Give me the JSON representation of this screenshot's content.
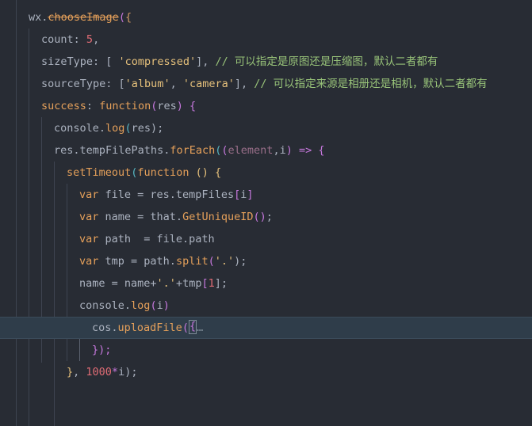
{
  "colors": {
    "background": "#282c34",
    "current_line": "#2f3d4a",
    "comment": "#98c379",
    "string": "#e5c07b",
    "keyword": "#c678dd",
    "function": "#61afef",
    "number": "#e06c75"
  },
  "lines": {
    "l0": {
      "tokens": [
        "wx",
        ".",
        "chooseImage",
        "(",
        "{"
      ]
    },
    "l1": {
      "tokens": [
        "count",
        ":",
        " ",
        "5",
        ","
      ]
    },
    "l2": {
      "tokens": [
        "sizeType",
        ": [ ",
        "'compressed'",
        "], ",
        "// 可以指定是原图还是压缩图，默认二者都有"
      ]
    },
    "l3": {
      "tokens": [
        "sourceType",
        ": [",
        "'album'",
        ", ",
        "'camera'",
        "], ",
        "// 可以指定来源是相册还是相机，默认二者都有"
      ]
    },
    "l4": {
      "tokens": [
        "success",
        ": ",
        "function",
        "(",
        "res",
        ") ",
        "{"
      ]
    },
    "l5": {
      "tokens": [
        "console",
        ".",
        "log",
        "(",
        "res",
        ");"
      ]
    },
    "l6": {
      "tokens": [
        "res",
        ".",
        "tempFilePaths",
        ".",
        "forEach",
        "(",
        "(",
        "element",
        ",",
        "i",
        ")",
        " => ",
        "{"
      ]
    },
    "l7": {
      "tokens": [
        "setTimeout",
        "(",
        "function",
        " ",
        "()",
        " ",
        "{"
      ]
    },
    "l8": {
      "tokens": [
        "var",
        " file = res.tempFiles",
        "[",
        "i",
        "]"
      ]
    },
    "l9": {
      "tokens": [
        "var",
        " name = that.",
        "GetUniqueID",
        "()",
        ";"
      ]
    },
    "l10": {
      "tokens": [
        "var",
        " path  = file.path"
      ]
    },
    "l11": {
      "tokens": [
        "var",
        " tmp = path.",
        "split",
        "(",
        "'.'",
        ");"
      ]
    },
    "l12": {
      "tokens": [
        "name = name+",
        "'.'",
        "+tmp",
        "[",
        "1",
        "];"
      ]
    },
    "l13": {
      "tokens": [
        "console",
        ".",
        "log",
        "(",
        "i",
        ")"
      ]
    },
    "l14": {
      "tokens": [
        "cos",
        ".",
        "uploadFile",
        "(",
        "{",
        "…"
      ]
    },
    "l15": {
      "tokens": [
        "});"
      ]
    },
    "l16": {
      "tokens": [
        "}",
        ", ",
        "1000",
        "*",
        "i",
        ");"
      ]
    }
  }
}
